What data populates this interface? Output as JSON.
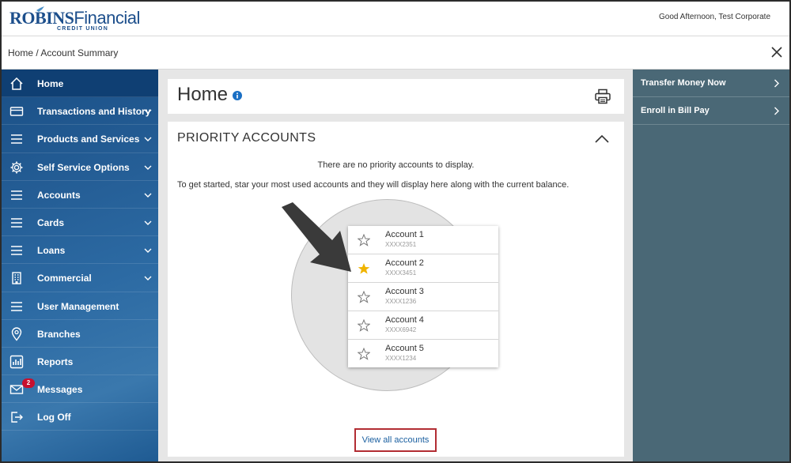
{
  "header": {
    "logo_robins": "ROBINS",
    "logo_financial": "Financial",
    "logo_sub": "CREDIT UNION",
    "greeting": "Good Afternoon, Test Corporate"
  },
  "breadcrumb": "Home / Account Summary",
  "sidebar": {
    "items": [
      {
        "label": "Home",
        "icon": "home-icon",
        "chevron": false,
        "active": true
      },
      {
        "label": "Transactions and History",
        "icon": "card-icon",
        "chevron": true
      },
      {
        "label": "Products and Services",
        "icon": "menu-icon",
        "chevron": true
      },
      {
        "label": "Self Service Options",
        "icon": "gear-icon",
        "chevron": true
      },
      {
        "label": "Accounts",
        "icon": "menu-icon",
        "chevron": true
      },
      {
        "label": "Cards",
        "icon": "menu-icon",
        "chevron": true
      },
      {
        "label": "Loans",
        "icon": "menu-icon",
        "chevron": true
      },
      {
        "label": "Commercial",
        "icon": "building-icon",
        "chevron": true
      },
      {
        "label": "User Management",
        "icon": "menu-icon",
        "chevron": false
      },
      {
        "label": "Branches",
        "icon": "location-pin-icon",
        "chevron": false
      },
      {
        "label": "Reports",
        "icon": "bar-chart-icon",
        "chevron": false
      },
      {
        "label": "Messages",
        "icon": "envelope-icon",
        "chevron": false,
        "badge": "2"
      },
      {
        "label": "Log Off",
        "icon": "logout-icon",
        "chevron": false
      }
    ]
  },
  "main": {
    "title": "Home",
    "priority": {
      "heading": "PRIORITY ACCOUNTS",
      "empty": "There are no priority accounts to display.",
      "hint": "To get started, star your most used accounts and they will display here along with the current balance.",
      "accounts": [
        {
          "name": "Account 1",
          "number": "XXXX2351",
          "starred": false
        },
        {
          "name": "Account 2",
          "number": "XXXX3451",
          "starred": true
        },
        {
          "name": "Account 3",
          "number": "XXXX1236",
          "starred": false
        },
        {
          "name": "Account 4",
          "number": "XXXX6942",
          "starred": false
        },
        {
          "name": "Account 5",
          "number": "XXXX1234",
          "starred": false
        }
      ],
      "view_all": "View all accounts"
    }
  },
  "right_panel": {
    "items": [
      {
        "label": "Transfer Money Now"
      },
      {
        "label": "Enroll in Bill Pay"
      }
    ]
  },
  "colors": {
    "brand": "#1d4f8c",
    "sidebar_active": "#0f3f73",
    "right_panel": "#4a6876",
    "star": "#f0b400",
    "highlight_border": "#b22d33",
    "link": "#1a5fa0",
    "badge": "#c8102e"
  }
}
